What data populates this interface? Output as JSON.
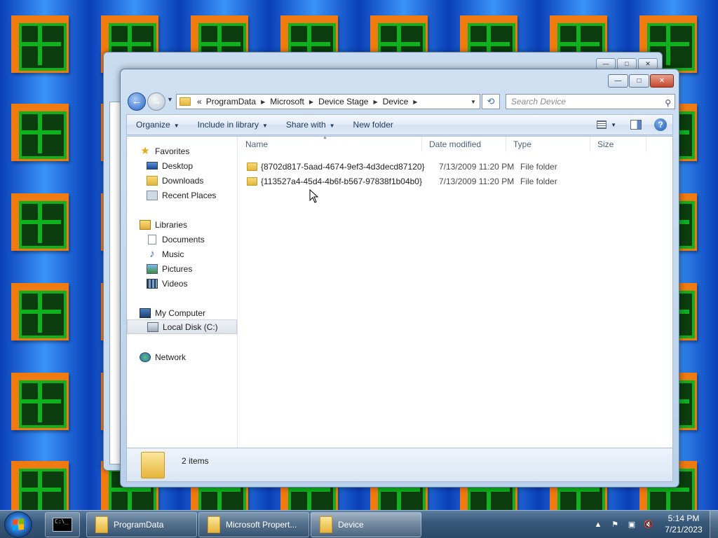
{
  "explorer": {
    "address_prefix": "«",
    "breadcrumb": [
      "ProgramData",
      "Microsoft",
      "Device Stage",
      "Device"
    ],
    "search_placeholder": "Search Device",
    "toolbar": {
      "organize": "Organize",
      "include_in_library": "Include in library",
      "share_with": "Share with",
      "new_folder": "New folder"
    },
    "columns": [
      "Name",
      "Date modified",
      "Type",
      "Size"
    ],
    "files": [
      {
        "name": "{8702d817-5aad-4674-9ef3-4d3decd87120}",
        "date": "7/13/2009 11:20 PM",
        "type": "File folder",
        "size": ""
      },
      {
        "name": "{113527a4-45d4-4b6f-b567-97838f1b04b0}",
        "date": "7/13/2009 11:20 PM",
        "type": "File folder",
        "size": ""
      }
    ],
    "nav": {
      "favorites": "Favorites",
      "desktop": "Desktop",
      "downloads": "Downloads",
      "recent_places": "Recent Places",
      "libraries": "Libraries",
      "documents": "Documents",
      "music": "Music",
      "pictures": "Pictures",
      "videos": "Videos",
      "my_computer": "My Computer",
      "local_disk": "Local Disk (C:)",
      "network": "Network"
    },
    "details": {
      "item_count": "2 items"
    }
  },
  "taskbar": {
    "cmd_icon_text": "C:\\_",
    "buttons": [
      {
        "label": "ProgramData"
      },
      {
        "label": "Microsoft Propert..."
      },
      {
        "label": "Device"
      }
    ],
    "clock": {
      "time": "5:14 PM",
      "date": "7/21/2023"
    }
  },
  "colors": {
    "wallpaper_blue": "#1b6fe0",
    "tile_orange": "#f07a12",
    "tile_green": "#10b01e",
    "window_frame": "#b9d0ea",
    "close_red": "#c5462b"
  },
  "icons": {
    "back": "back-arrow-icon",
    "forward": "forward-arrow-icon",
    "refresh": "refresh-icon",
    "search": "search-icon",
    "help": "help-icon"
  }
}
